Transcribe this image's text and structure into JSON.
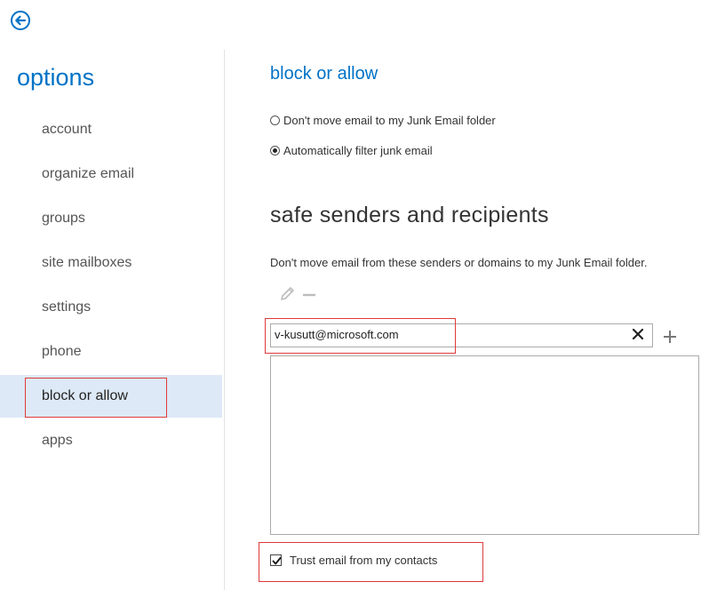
{
  "sidebar": {
    "title": "options",
    "items": [
      {
        "label": "account",
        "active": false
      },
      {
        "label": "organize email",
        "active": false
      },
      {
        "label": "groups",
        "active": false
      },
      {
        "label": "site mailboxes",
        "active": false
      },
      {
        "label": "settings",
        "active": false
      },
      {
        "label": "phone",
        "active": false
      },
      {
        "label": "block or allow",
        "active": true
      },
      {
        "label": "apps",
        "active": false
      }
    ]
  },
  "main": {
    "section_title": "block or allow",
    "radio_options": [
      {
        "label": "Don't move email to my Junk Email folder",
        "checked": false
      },
      {
        "label": "Automatically filter junk email",
        "checked": true
      }
    ],
    "safe_heading": "safe senders and recipients",
    "safe_description": "Don't move email from these senders or domains to my Junk Email folder.",
    "email_input_value": "v-kusutt@microsoft.com",
    "trust_contacts_label": "Trust email from my contacts",
    "trust_contacts_checked": true
  },
  "colors": {
    "accent": "#0072c6",
    "active_nav_bg": "#dde9f7",
    "highlight": "#e03a3a"
  }
}
